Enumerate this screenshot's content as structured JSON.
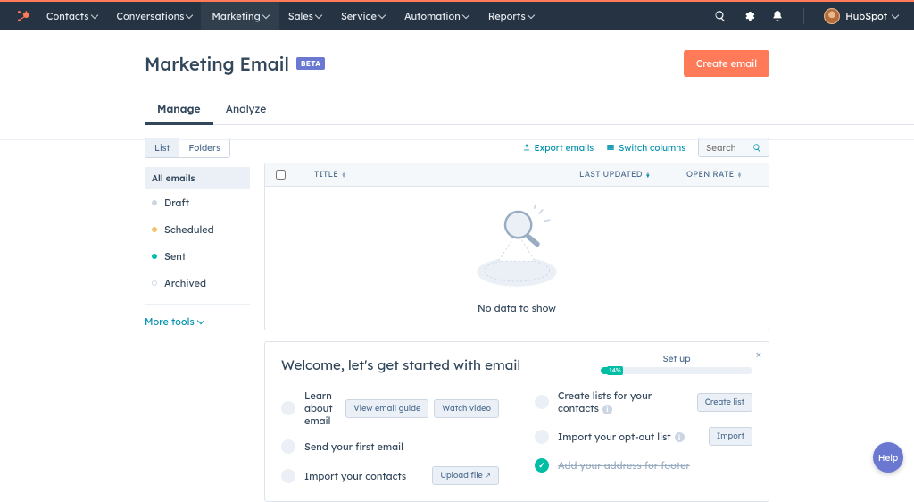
{
  "nav": {
    "items": [
      {
        "label": "Contacts"
      },
      {
        "label": "Conversations"
      },
      {
        "label": "Marketing",
        "active": true
      },
      {
        "label": "Sales"
      },
      {
        "label": "Service"
      },
      {
        "label": "Automation"
      },
      {
        "label": "Reports"
      }
    ],
    "account_label": "HubSpot"
  },
  "header": {
    "title": "Marketing Email",
    "badge": "BETA",
    "create_btn": "Create email"
  },
  "tabs": [
    "Manage",
    "Analyze"
  ],
  "sidebar": {
    "toggle": [
      "List",
      "Folders"
    ],
    "group_title": "All emails",
    "filters": [
      {
        "label": "Draft",
        "dot": "gray"
      },
      {
        "label": "Scheduled",
        "dot": "amber"
      },
      {
        "label": "Sent",
        "dot": "teal"
      },
      {
        "label": "Archived",
        "dot": "hollow"
      }
    ],
    "more_tools": "More tools"
  },
  "toolbar": {
    "export": "Export emails",
    "switch": "Switch columns",
    "search_placeholder": "Search"
  },
  "table": {
    "col_title": "TITLE",
    "col_last": "LAST UPDATED",
    "col_open": "OPEN RATE",
    "empty_text": "No data to show"
  },
  "onboard": {
    "title": "Welcome, let's get started with email",
    "setup_label": "Set up",
    "progress_pct": "14%",
    "left": [
      {
        "label": "Learn about email",
        "actions": [
          "View email guide",
          "Watch video"
        ]
      },
      {
        "label": "Send your first email"
      },
      {
        "label": "Import your contacts",
        "actions": [
          "Upload file"
        ],
        "uploadExt": true
      }
    ],
    "right": [
      {
        "label": "Create lists for your contacts",
        "info": true,
        "actions": [
          "Create list"
        ]
      },
      {
        "label": "Import your opt-out list",
        "info": true,
        "actions": [
          "Import"
        ]
      },
      {
        "label": "Add your address for footer",
        "done": true,
        "strike": true
      }
    ]
  },
  "help": "Help"
}
